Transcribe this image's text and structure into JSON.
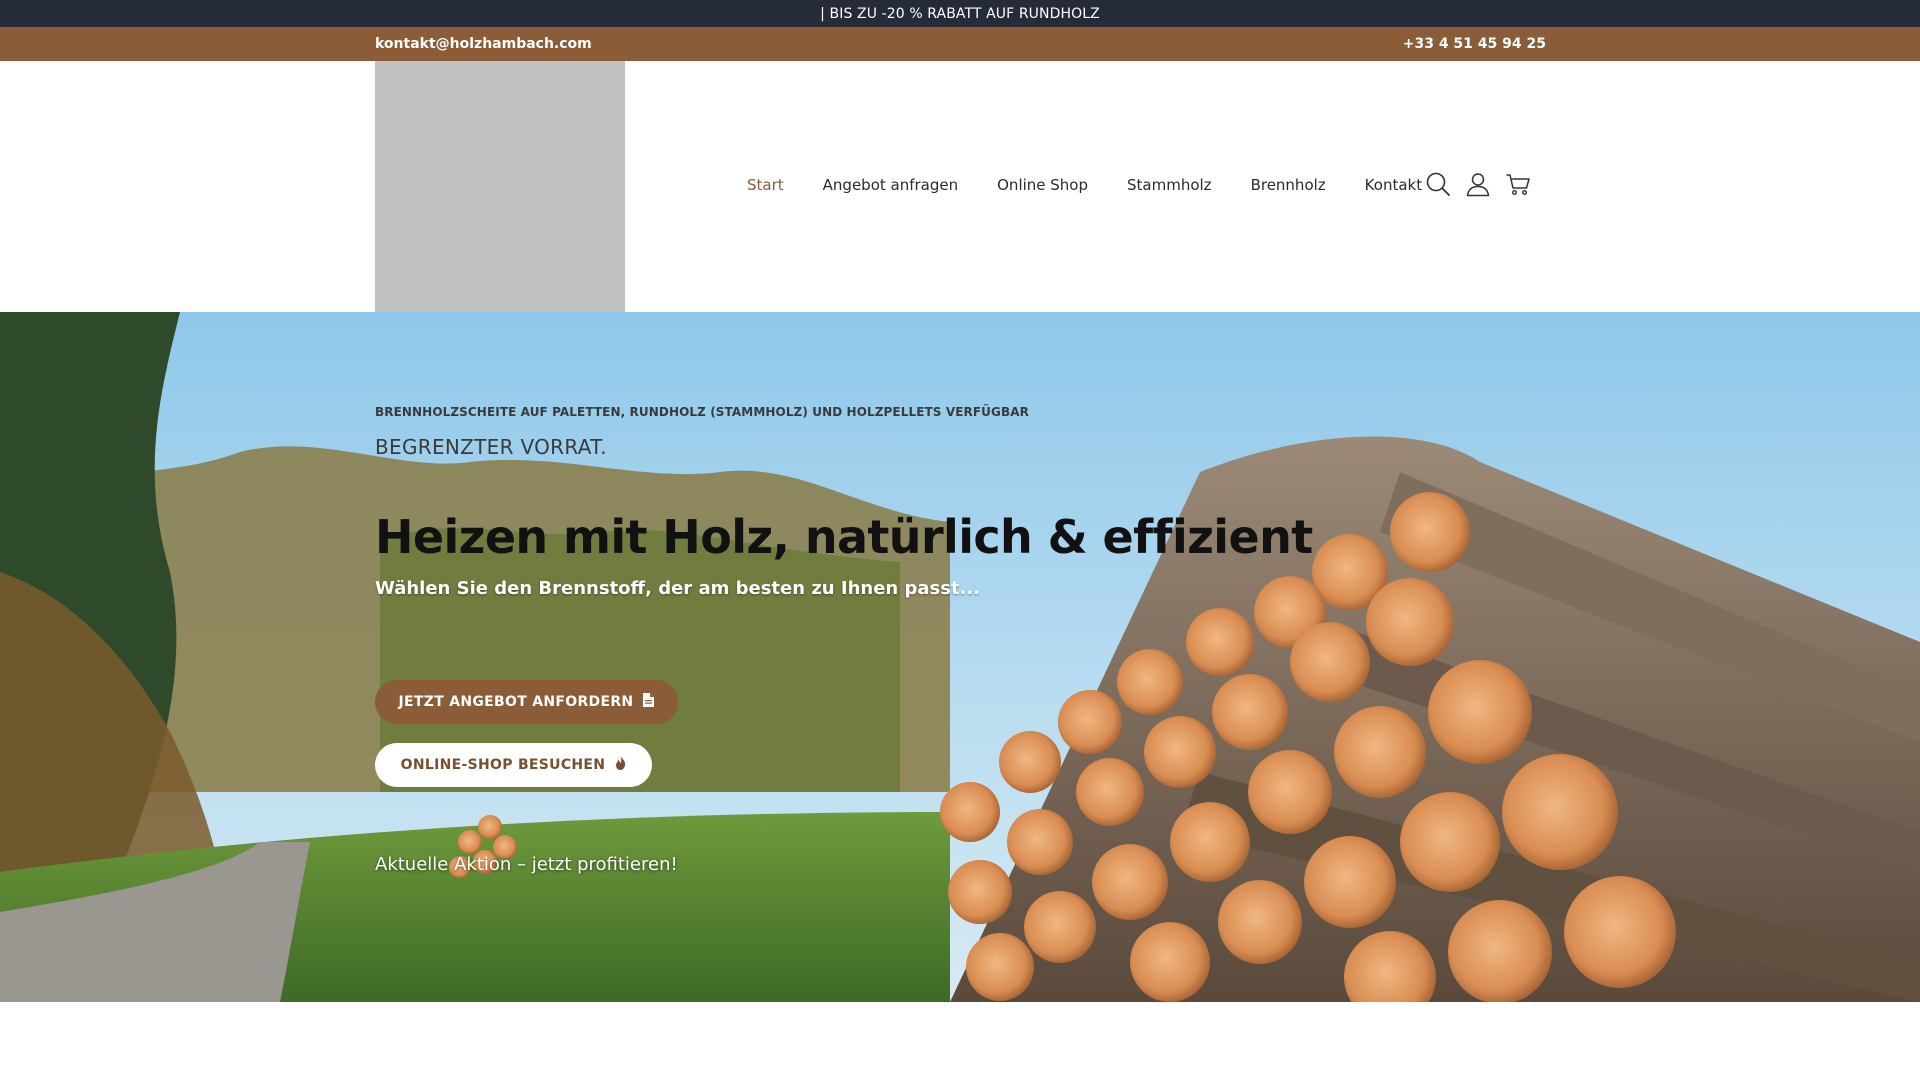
{
  "promo_bar": {
    "text": "| BIS ZU -20 % RABATT AUF RUNDHOLZ"
  },
  "contact_bar": {
    "email": "kontakt@holzhambach.com",
    "phone": "+33 4 51 45 94 25"
  },
  "nav": {
    "items": [
      {
        "label": "Start",
        "active": true
      },
      {
        "label": "Angebot anfragen"
      },
      {
        "label": "Online Shop"
      },
      {
        "label": "Stammholz"
      },
      {
        "label": "Brennholz"
      },
      {
        "label": "Kontakt"
      }
    ],
    "icons": [
      "search-icon",
      "user-icon",
      "cart-icon"
    ]
  },
  "hero": {
    "eyebrow": "BRENNHOLZSCHEITE AUF PALETTEN, RUNDHOLZ (STAMMHOLZ) UND HOLZPELLETS VERFÜGBAR",
    "subhead": "BEGRENZTER VORRAT.",
    "headline": "Heizen mit Holz, natürlich & effizient",
    "tagline": "Wählen Sie den Brennstoff, der am besten zu Ihnen passt...",
    "primary_button": "JETZT ANGEBOT ANFORDERN",
    "secondary_button": "ONLINE-SHOP BESUCHEN",
    "promo_link": "Aktuelle Aktion – jetzt profitieren!"
  },
  "colors": {
    "promo_bar_bg": "#252b37",
    "accent_brown": "#8a5c38",
    "logo_placeholder": "#c2c2c2"
  }
}
